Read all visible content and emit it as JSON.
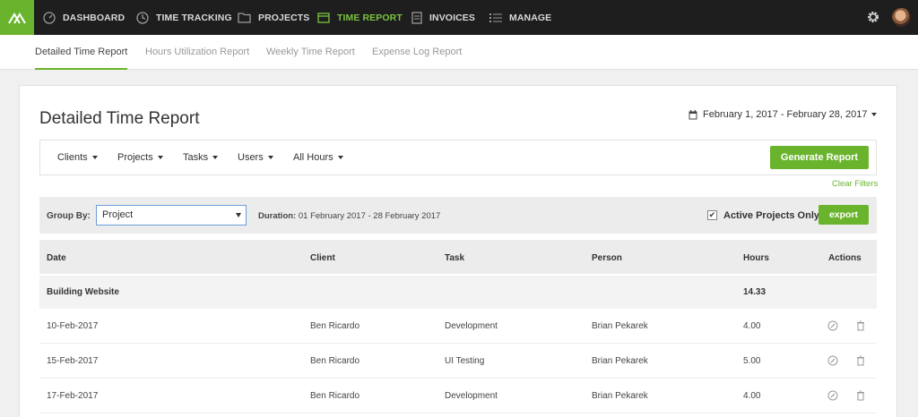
{
  "nav": {
    "items": [
      {
        "label": "DASHBOARD",
        "icon": "dashboard-icon"
      },
      {
        "label": "TIME TRACKING",
        "icon": "clock-icon"
      },
      {
        "label": "PROJECTS",
        "icon": "folder-icon"
      },
      {
        "label": "TIME REPORT",
        "icon": "report-icon",
        "active": true
      },
      {
        "label": "INVOICES",
        "icon": "invoice-icon"
      },
      {
        "label": "MANAGE",
        "icon": "list-icon"
      }
    ]
  },
  "subnav": {
    "tabs": [
      {
        "label": "Detailed Time Report",
        "active": true
      },
      {
        "label": "Hours Utilization Report"
      },
      {
        "label": "Weekly Time Report"
      },
      {
        "label": "Expense Log Report"
      }
    ]
  },
  "page": {
    "title": "Detailed Time Report",
    "date_range": "February 1, 2017 - February 28, 2017"
  },
  "filters": {
    "clients": "Clients",
    "projects": "Projects",
    "tasks": "Tasks",
    "users": "Users",
    "hours": "All Hours",
    "generate": "Generate Report",
    "clear": "Clear Filters"
  },
  "grouping": {
    "label": "Group By:",
    "value": "Project",
    "duration_label": "Duration:",
    "duration_value": "01 February 2017 - 28 February 2017",
    "active_only": "Active Projects Only",
    "active_checked": "✔",
    "export": "export"
  },
  "table": {
    "headers": {
      "date": "Date",
      "client": "Client",
      "task": "Task",
      "person": "Person",
      "hours": "Hours",
      "actions": "Actions"
    },
    "group": {
      "name": "Building Website",
      "total": "14.33"
    },
    "rows": [
      {
        "date": "10-Feb-2017",
        "client": "Ben Ricardo",
        "task": "Development",
        "person": "Brian Pekarek",
        "hours": "4.00"
      },
      {
        "date": "15-Feb-2017",
        "client": "Ben Ricardo",
        "task": "UI Testing",
        "person": "Brian Pekarek",
        "hours": "5.00"
      },
      {
        "date": "17-Feb-2017",
        "client": "Ben Ricardo",
        "task": "Development",
        "person": "Brian Pekarek",
        "hours": "4.00"
      }
    ]
  },
  "colors": {
    "accent": "#6ab42d",
    "nav_bg": "#1e1e1e"
  }
}
